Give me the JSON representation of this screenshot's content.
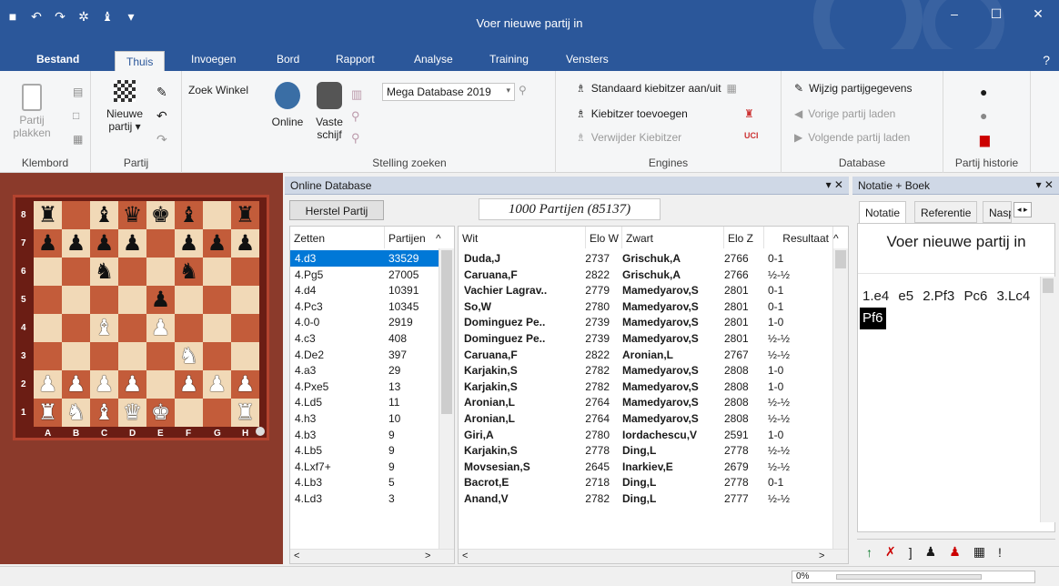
{
  "window": {
    "title": "Voer nieuwe partij in"
  },
  "tabs": [
    "Bestand",
    "Thuis",
    "Invoegen",
    "Bord",
    "Rapport",
    "Analyse",
    "Training",
    "Vensters"
  ],
  "ribbon": {
    "klembord": {
      "label": "Klembord",
      "paste": "Partij",
      "paste2": "plakken"
    },
    "partij": {
      "label": "Partij",
      "new": "Nieuwe",
      "new2": "partij ▾"
    },
    "zoek_winkel": "Zoek Winkel",
    "stelling": {
      "label": "Stelling zoeken",
      "online": "Online",
      "vaste": "Vaste",
      "vaste2": "schijf",
      "db": "Mega Database 2019"
    },
    "engines": {
      "label": "Engines",
      "std": "Standaard kiebitzer aan/uit",
      "add": "Kiebitzer toevoegen",
      "remove": "Verwijder Kiebitzer"
    },
    "database": {
      "label": "Database",
      "edit": "Wijzig partijgegevens",
      "prev": "Vorige partij laden",
      "next": "Volgende partij laden"
    },
    "historie": {
      "label": "Partij historie"
    }
  },
  "board": {
    "ranks": [
      "8",
      "7",
      "6",
      "5",
      "4",
      "3",
      "2",
      "1"
    ],
    "files": [
      "A",
      "B",
      "C",
      "D",
      "E",
      "F",
      "G",
      "H"
    ],
    "rows": [
      [
        "bR",
        "",
        "bB",
        "bQ",
        "bK",
        "bB",
        "",
        "bR"
      ],
      [
        "bP",
        "bP",
        "bP",
        "bP",
        "",
        "bP",
        "bP",
        "bP"
      ],
      [
        "",
        "",
        "bN",
        "",
        "",
        "bN",
        "",
        ""
      ],
      [
        "",
        "",
        "",
        "",
        "bP",
        "",
        "",
        ""
      ],
      [
        "",
        "",
        "wB",
        "",
        "wP",
        "",
        "",
        ""
      ],
      [
        "",
        "",
        "",
        "",
        "",
        "wN",
        "",
        ""
      ],
      [
        "wP",
        "wP",
        "wP",
        "wP",
        "",
        "wP",
        "wP",
        "wP"
      ],
      [
        "wR",
        "wN",
        "wB",
        "wQ",
        "wK",
        "",
        "",
        "wR"
      ]
    ]
  },
  "online_db": {
    "title": "Online Database",
    "reset": "Herstel Partij",
    "games": "1000 Partijen (85137)",
    "moves_headers": [
      "Zetten",
      "Partijen"
    ],
    "moves": [
      [
        "4.d3",
        "33529"
      ],
      [
        "4.Pg5",
        "27005"
      ],
      [
        "4.d4",
        "10391"
      ],
      [
        "4.Pc3",
        "10345"
      ],
      [
        "4.0-0",
        "2919"
      ],
      [
        "4.c3",
        "408"
      ],
      [
        "4.De2",
        "397"
      ],
      [
        "4.a3",
        "29"
      ],
      [
        "4.Pxe5",
        "13"
      ],
      [
        "4.Ld5",
        "11"
      ],
      [
        "4.h3",
        "10"
      ],
      [
        "4.b3",
        "9"
      ],
      [
        "4.Lb5",
        "9"
      ],
      [
        "4.Lxf7+",
        "9"
      ],
      [
        "4.Lb3",
        "5"
      ],
      [
        "4.Ld3",
        "3"
      ]
    ],
    "game_headers": [
      "Wit",
      "Elo W",
      "Zwart",
      "Elo Z",
      "Resultaat"
    ],
    "games_list": [
      [
        "Duda,J",
        "2737",
        "Grischuk,A",
        "2766",
        "0-1"
      ],
      [
        "Caruana,F",
        "2822",
        "Grischuk,A",
        "2766",
        "½-½"
      ],
      [
        "Vachier Lagrav..",
        "2779",
        "Mamedyarov,S",
        "2801",
        "0-1"
      ],
      [
        "So,W",
        "2780",
        "Mamedyarov,S",
        "2801",
        "0-1"
      ],
      [
        "Dominguez Pe..",
        "2739",
        "Mamedyarov,S",
        "2801",
        "1-0"
      ],
      [
        "Dominguez Pe..",
        "2739",
        "Mamedyarov,S",
        "2801",
        "½-½"
      ],
      [
        "Caruana,F",
        "2822",
        "Aronian,L",
        "2767",
        "½-½"
      ],
      [
        "Karjakin,S",
        "2782",
        "Mamedyarov,S",
        "2808",
        "1-0"
      ],
      [
        "Karjakin,S",
        "2782",
        "Mamedyarov,S",
        "2808",
        "1-0"
      ],
      [
        "Aronian,L",
        "2764",
        "Mamedyarov,S",
        "2808",
        "½-½"
      ],
      [
        "Aronian,L",
        "2764",
        "Mamedyarov,S",
        "2808",
        "½-½"
      ],
      [
        "Giri,A",
        "2780",
        "Iordachescu,V",
        "2591",
        "1-0"
      ],
      [
        "Karjakin,S",
        "2778",
        "Ding,L",
        "2778",
        "½-½"
      ],
      [
        "Movsesian,S",
        "2645",
        "Inarkiev,E",
        "2679",
        "½-½"
      ],
      [
        "Bacrot,E",
        "2718",
        "Ding,L",
        "2778",
        "0-1"
      ],
      [
        "Anand,V",
        "2782",
        "Ding,L",
        "2777",
        "½-½"
      ]
    ]
  },
  "notation": {
    "title": "Notatie + Boek",
    "tabs": [
      "Notatie",
      "Referentie",
      "Nasp"
    ],
    "heading": "Voer nieuwe partij in",
    "moves": [
      "1.e4",
      "e5",
      "2.Pf3",
      "Pc6",
      "3.Lc4",
      "Pf6"
    ]
  },
  "status": {
    "progress": "0%"
  }
}
